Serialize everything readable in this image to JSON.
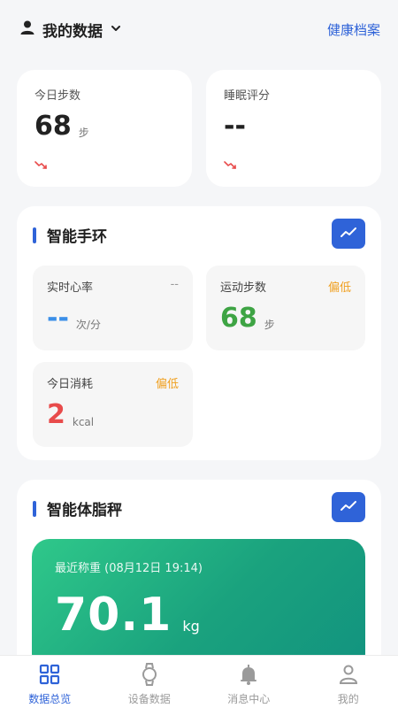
{
  "header": {
    "title": "我的数据",
    "link": "健康档案"
  },
  "summary": [
    {
      "label": "今日步数",
      "value": "68",
      "unit": "步"
    },
    {
      "label": "睡眠评分",
      "value": "--",
      "unit": ""
    }
  ],
  "band": {
    "title": "智能手环",
    "tiles": [
      {
        "label": "实时心率",
        "status": "--",
        "value": "--",
        "unit": "次/分",
        "value_color": "#3b8fe8",
        "status_color": "#999999"
      },
      {
        "label": "运动步数",
        "status": "偏低",
        "value": "68",
        "unit": "步",
        "value_color": "#3ea444",
        "status_color": "#f0a020"
      },
      {
        "label": "今日消耗",
        "status": "偏低",
        "value": "2",
        "unit": "kcal",
        "value_color": "#e84b4b",
        "status_color": "#f0a020"
      }
    ]
  },
  "scale": {
    "title": "智能体脂秤",
    "recent_label": "最近称重 (08月12日 19:14)",
    "weight": "70.1",
    "unit": "kg"
  },
  "tabs": [
    {
      "label": "数据总览",
      "icon": "grid-icon",
      "active": true
    },
    {
      "label": "设备数据",
      "icon": "watch-icon",
      "active": false
    },
    {
      "label": "消息中心",
      "icon": "bell-icon",
      "active": false
    },
    {
      "label": "我的",
      "icon": "person-icon",
      "active": false
    }
  ],
  "colors": {
    "accent": "#2f63d8",
    "active_tab": "#2f63d8",
    "inactive_tab": "#9a9a9a"
  }
}
